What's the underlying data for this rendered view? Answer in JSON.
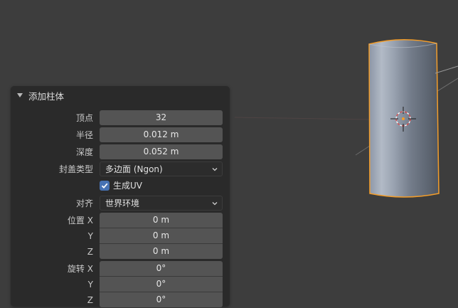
{
  "panel": {
    "title": "添加柱体",
    "vertices": {
      "label": "顶点",
      "value": "32"
    },
    "radius": {
      "label": "半径",
      "value": "0.012 m"
    },
    "depth": {
      "label": "深度",
      "value": "0.052 m"
    },
    "cap_fill": {
      "label": "封盖类型",
      "value": "多边面 (Ngon)"
    },
    "generate_uv": {
      "label": "生成UV",
      "checked": true
    },
    "align": {
      "label": "对齐",
      "value": "世界环境"
    },
    "location": {
      "label": "位置",
      "x": {
        "axis": "X",
        "value": "0 m"
      },
      "y": {
        "axis": "Y",
        "value": "0 m"
      },
      "z": {
        "axis": "Z",
        "value": "0 m"
      }
    },
    "rotation": {
      "label": "旋转",
      "x": {
        "axis": "X",
        "value": "0°"
      },
      "y": {
        "axis": "Y",
        "value": "0°"
      },
      "z": {
        "axis": "Z",
        "value": "0°"
      }
    }
  },
  "colors": {
    "selection_outline": "#f29d2b",
    "checkbox_accent": "#4772b3",
    "viewport_bg": "#3d3d3d"
  }
}
